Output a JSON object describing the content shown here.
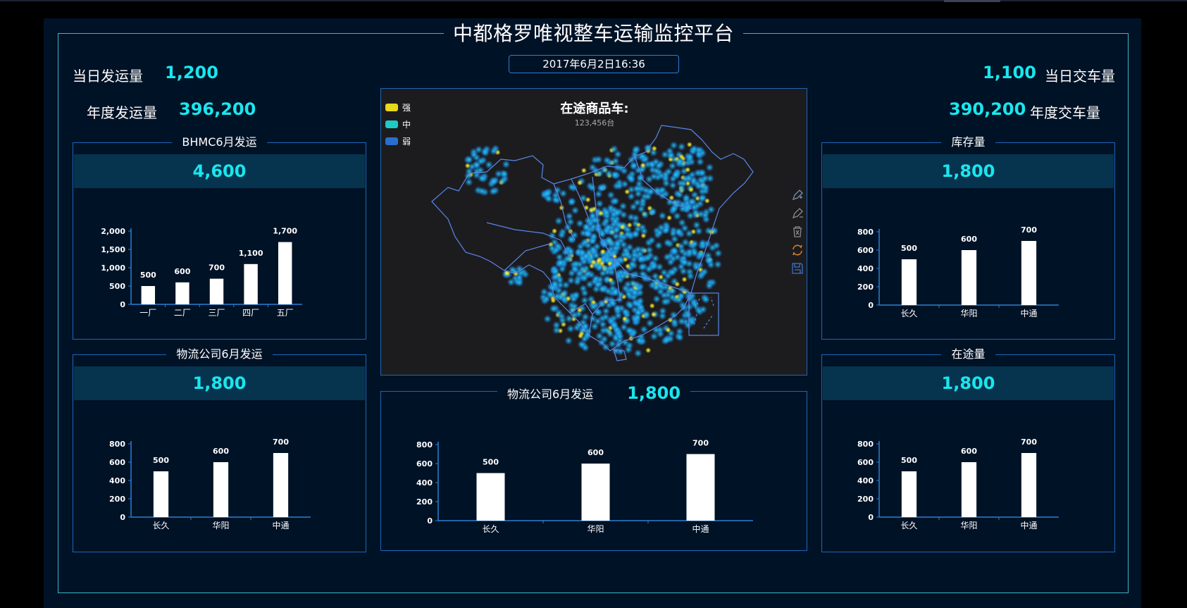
{
  "header": {
    "title": "中都格罗唯视整车运输监控平台",
    "datetime": "2017年6月2日16:36"
  },
  "stats": {
    "daily_ship_label": "当日发运量",
    "daily_ship_value": "1,200",
    "annual_ship_label": "年度发运量",
    "annual_ship_value": "396,200",
    "daily_deliver_value": "1,100",
    "daily_deliver_label": "当日交车量",
    "annual_deliver_value": "390,200",
    "annual_deliver_label": "年度交车量"
  },
  "panels": {
    "bhmc": {
      "title": "BHMC6月发运",
      "total": "4,600"
    },
    "logistics_left": {
      "title": "物流公司6月发运",
      "total": "1,800"
    },
    "inventory": {
      "title": "库存量",
      "total": "1,800"
    },
    "in_transit": {
      "title": "在途量",
      "total": "1,800"
    },
    "logistics_center": {
      "title": "物流公司6月发运",
      "total": "1,800"
    }
  },
  "map": {
    "title": "在途商品车:",
    "subtitle": "123,456台",
    "legend": [
      {
        "label": "强",
        "color": "#e6d81a"
      },
      {
        "label": "中",
        "color": "#1fc9c4"
      },
      {
        "label": "弱",
        "color": "#2a6fd0"
      }
    ],
    "tools": [
      "pen-plus-icon",
      "pen-minus-icon",
      "trash-icon",
      "refresh-icon",
      "save-icon"
    ]
  },
  "chart_data": [
    {
      "id": "bhmc",
      "type": "bar",
      "categories": [
        "一厂",
        "二厂",
        "三厂",
        "四厂",
        "五厂"
      ],
      "values": [
        500,
        600,
        700,
        1100,
        1700
      ],
      "ylim": [
        0,
        2000
      ],
      "yticks": [
        0,
        500,
        1000,
        1500,
        2000
      ],
      "ytick_labels": [
        "0",
        "500",
        "1,000",
        "1,500",
        "2,000"
      ],
      "data_labels": [
        "500",
        "600",
        "700",
        "1,100",
        "1,700"
      ],
      "bar_color": "#ffffff",
      "axis_color": "#2a7fd4",
      "grid": false
    },
    {
      "id": "logistics_left",
      "type": "bar",
      "categories": [
        "长久",
        "华阳",
        "中通"
      ],
      "values": [
        500,
        600,
        700
      ],
      "ylim": [
        0,
        800
      ],
      "yticks": [
        0,
        200,
        400,
        600,
        800
      ],
      "ytick_labels": [
        "0",
        "200",
        "400",
        "600",
        "800"
      ],
      "data_labels": [
        "500",
        "600",
        "700"
      ],
      "bar_color": "#ffffff",
      "axis_color": "#2a7fd4",
      "grid": false
    },
    {
      "id": "inventory",
      "type": "bar",
      "categories": [
        "长久",
        "华阳",
        "中通"
      ],
      "values": [
        500,
        600,
        700
      ],
      "ylim": [
        0,
        800
      ],
      "yticks": [
        0,
        200,
        400,
        600,
        800
      ],
      "ytick_labels": [
        "0",
        "200",
        "400",
        "600",
        "800"
      ],
      "data_labels": [
        "500",
        "600",
        "700"
      ],
      "bar_color": "#ffffff",
      "axis_color": "#2a7fd4",
      "grid": false
    },
    {
      "id": "in_transit",
      "type": "bar",
      "categories": [
        "长久",
        "华阳",
        "中通"
      ],
      "values": [
        500,
        600,
        700
      ],
      "ylim": [
        0,
        800
      ],
      "yticks": [
        0,
        200,
        400,
        600,
        800
      ],
      "ytick_labels": [
        "0",
        "200",
        "400",
        "600",
        "800"
      ],
      "data_labels": [
        "500",
        "600",
        "700"
      ],
      "bar_color": "#ffffff",
      "axis_color": "#2a7fd4",
      "grid": false
    },
    {
      "id": "logistics_center",
      "type": "bar",
      "categories": [
        "长久",
        "华阳",
        "中通"
      ],
      "values": [
        500,
        600,
        700
      ],
      "ylim": [
        0,
        800
      ],
      "yticks": [
        0,
        200,
        400,
        600,
        800
      ],
      "ytick_labels": [
        "0",
        "200",
        "400",
        "600",
        "800"
      ],
      "data_labels": [
        "500",
        "600",
        "700"
      ],
      "bar_color": "#ffffff",
      "axis_color": "#2a7fd4",
      "grid": false
    }
  ]
}
